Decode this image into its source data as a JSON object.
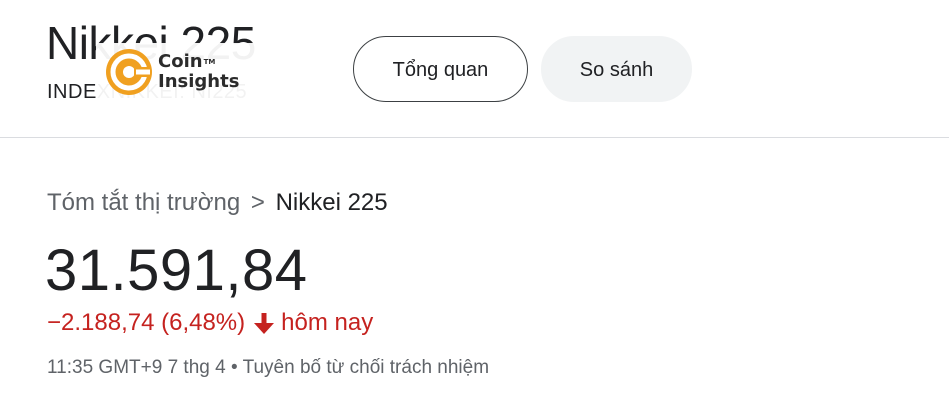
{
  "header": {
    "title": "Nikkei 225",
    "subtitle": "INDEXNIKKEI: NI225"
  },
  "watermark": {
    "line1": "Coin",
    "line2": "Insights",
    "tm": "TM",
    "color": "#f0a020"
  },
  "tabs": [
    {
      "label": "Tổng quan",
      "active": true
    },
    {
      "label": "So sánh",
      "active": false
    }
  ],
  "breadcrumb": {
    "root": "Tóm tắt thị trường",
    "separator": ">",
    "current": "Nikkei 225"
  },
  "quote": {
    "price": "31.591,84",
    "change": "−2.188,74 (6,48%)",
    "direction_icon": "arrow-down-icon",
    "period": "hôm nay",
    "change_color": "#c5221f"
  },
  "footer": {
    "timestamp": "11:35 GMT+9 7 thg 4",
    "bullet": "•",
    "disclaimer": "Tuyên bố từ chối trách nhiệm"
  }
}
